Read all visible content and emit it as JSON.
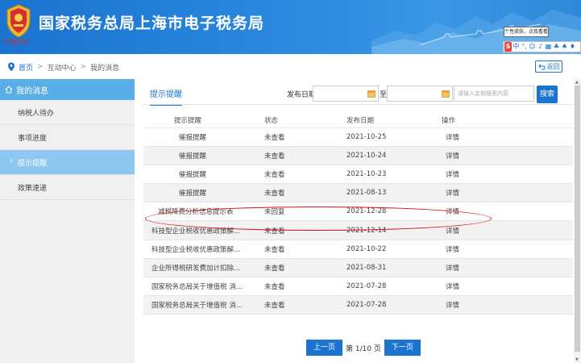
{
  "header": {
    "title": "国家税务总局上海市电子税务局",
    "emblem_text": "中国税务",
    "brand_color": "#1a73cf"
  },
  "ime": {
    "tip": "个性皮肤，点我看看",
    "logo": "S",
    "icons": [
      "中",
      "°,",
      "☺",
      "♪",
      "▦",
      "♣",
      "♠",
      "♦"
    ]
  },
  "breadcrumb": {
    "items": [
      "首页",
      "互动中心",
      "我的消息"
    ],
    "separator": ">",
    "back_label": "返回"
  },
  "sidebar": {
    "title": "我的消息",
    "items": [
      {
        "label": "纳税人待办",
        "active": false
      },
      {
        "label": "事项进度",
        "active": false
      },
      {
        "label": "提示提醒",
        "active": true
      },
      {
        "label": "政策速递",
        "active": false
      }
    ]
  },
  "main": {
    "tab": "提示提醒",
    "filters": {
      "date_label": "发布日期",
      "to_label": "至",
      "search_placeholder": "请输入定期搜索内容",
      "search_button": "搜索"
    },
    "columns": [
      "提示提醒",
      "状态",
      "发布日期",
      "操作"
    ],
    "rows": [
      {
        "title": "催报提醒",
        "status": "未查看",
        "date": "2021-10-25",
        "action": "详情"
      },
      {
        "title": "催报提醒",
        "status": "未查看",
        "date": "2021-10-24",
        "action": "详情"
      },
      {
        "title": "催报提醒",
        "status": "未查看",
        "date": "2021-10-23",
        "action": "详情"
      },
      {
        "title": "催报提醒",
        "status": "未查看",
        "date": "2021-08-13",
        "action": "详情"
      },
      {
        "title": "减税降费分析信息提示表",
        "status": "未回复",
        "date": "2021-12-28",
        "action": "详情"
      },
      {
        "title": "科技型企业税收优惠政策解...",
        "status": "未查看",
        "date": "2021-12-14",
        "action": "详情"
      },
      {
        "title": "科技型企业税收优惠政策解...",
        "status": "未查看",
        "date": "2021-10-22",
        "action": "详情"
      },
      {
        "title": "企业所得税研发费加计扣除...",
        "status": "未查看",
        "date": "2021-08-31",
        "action": "详情"
      },
      {
        "title": "国家税务总局关于增值税 消...",
        "status": "未查看",
        "date": "2021-07-28",
        "action": "详情"
      },
      {
        "title": "国家税务总局关于增值税 消...",
        "status": "未查看",
        "date": "2021-07-28",
        "action": "详情"
      }
    ],
    "highlight_color": "#dd1111"
  },
  "pagination": {
    "prev_label": "上一页",
    "page_info": "第 1/10 页",
    "next_label": "下一页",
    "current_page": 1,
    "total_pages": 10
  }
}
